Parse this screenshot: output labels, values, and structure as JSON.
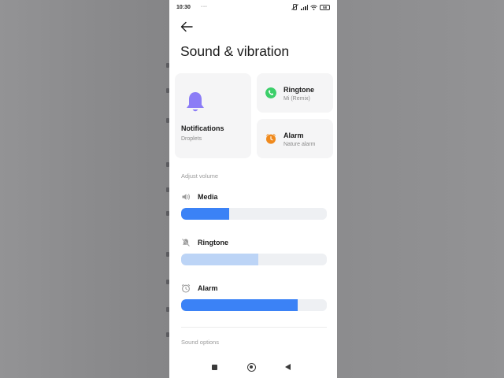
{
  "status_bar": {
    "time": "10:30",
    "dots": "···",
    "battery": "58"
  },
  "page": {
    "title": "Sound & vibration"
  },
  "cards": {
    "notifications": {
      "title": "Notifications",
      "subtitle": "Droplets",
      "icon": "bell-icon",
      "color": "#8b7cf6"
    },
    "ringtone": {
      "title": "Ringtone",
      "subtitle": "Mi (Remix)",
      "icon": "phone-icon",
      "color": "#3ccf6a"
    },
    "alarm": {
      "title": "Alarm",
      "subtitle": "Nature alarm",
      "icon": "alarm-clock-icon",
      "color": "#f08a1d"
    }
  },
  "volume": {
    "section_label": "Adjust volume",
    "sliders": [
      {
        "label": "Media",
        "icon": "speaker-icon",
        "level_percent": 33,
        "fill_color": "#3b82f6"
      },
      {
        "label": "Ringtone",
        "icon": "bell-muted-icon",
        "level_percent": 53,
        "fill_color": "#bcd4f6"
      },
      {
        "label": "Alarm",
        "icon": "alarm-clock-icon",
        "level_percent": 80,
        "fill_color": "#3b82f6"
      }
    ]
  },
  "sound_options": {
    "section_label": "Sound options"
  },
  "nav": {
    "recents": "recents-square-icon",
    "home": "home-circle-icon",
    "back": "back-triangle-icon"
  }
}
